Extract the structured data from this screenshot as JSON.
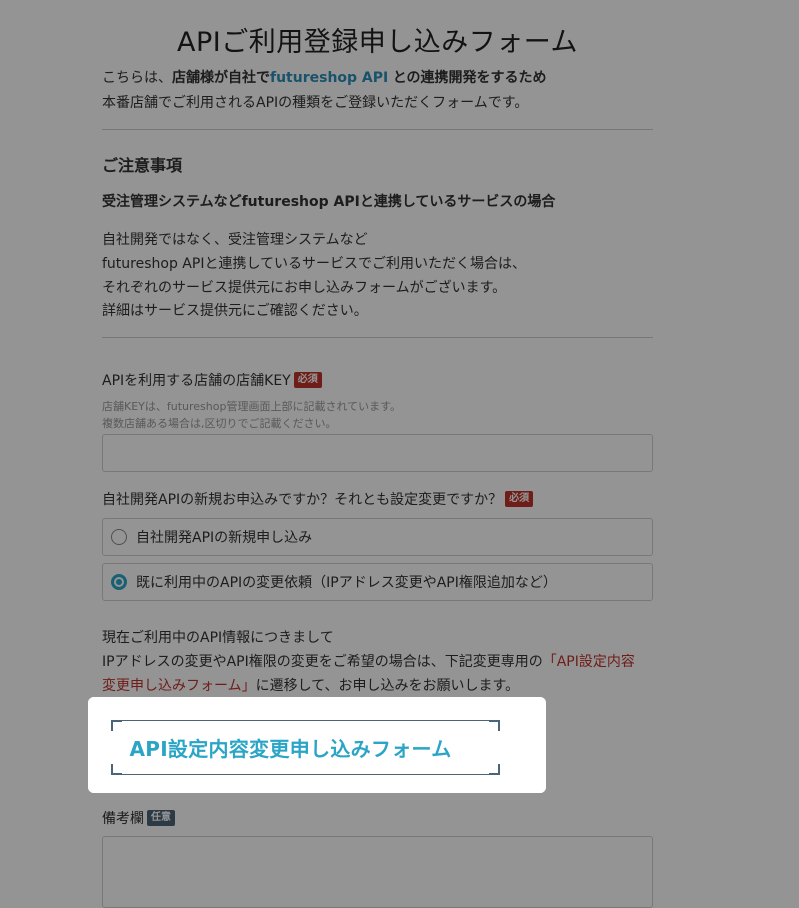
{
  "header": {
    "title": "APIご利用登録申し込みフォーム"
  },
  "intro": {
    "line1_prefix": "こちらは、",
    "line1_bold": "店舗様が自社で",
    "line1_link": "futureshop API",
    "line1_suffix": "との連携開発をするため",
    "line2": "本番店舗でご利用されるAPIの種類をご登録いただくフォームです。"
  },
  "notice": {
    "heading": "ご注意事項",
    "subheading": "受注管理システムなどfutureshop APIと連携しているサービスの場合",
    "lines": [
      "自社開発ではなく、受注管理システムなど",
      "futureshop APIと連携しているサービスでご利用いただく場合は、",
      "それぞれのサービス提供元にお申し込みフォームがございます。",
      "詳細はサービス提供元にご確認ください。"
    ]
  },
  "form": {
    "store_key": {
      "label": "APIを利用する店舗の店舗KEY",
      "badge": "必須",
      "help1": "店舗KEYは、futureshop管理画面上部に記載されています。",
      "help2": "複数店舗ある場合は,区切りでご記載ください。",
      "value": ""
    },
    "request_type": {
      "label": "自社開発APIの新規お申込みですか？それとも設定変更ですか？",
      "badge": "必須",
      "options": [
        {
          "label": "自社開発APIの新規申し込み",
          "selected": false
        },
        {
          "label": "既に利用中のAPIの変更依頼（IPアドレス変更やAPI権限追加など）",
          "selected": true
        }
      ]
    },
    "info": {
      "line1": "現在ご利用中のAPI情報につきまして",
      "line2_prefix": "IPアドレスの変更やAPI権限の変更をご希望の場合は、下記変更専用の",
      "line2_red": "「API設定内容",
      "line3_red": "変更申し込みフォーム」",
      "line3_suffix": "に遷移して、お申し込みをお願いします。"
    },
    "cta": {
      "label": "API設定内容変更申し込みフォーム"
    },
    "remarks": {
      "label": "備考欄",
      "badge": "任意",
      "value": ""
    }
  },
  "colors": {
    "accent": "#2aa5c6",
    "link": "#2a8fb8",
    "required": "#c0332a",
    "optional": "#4b6478"
  }
}
